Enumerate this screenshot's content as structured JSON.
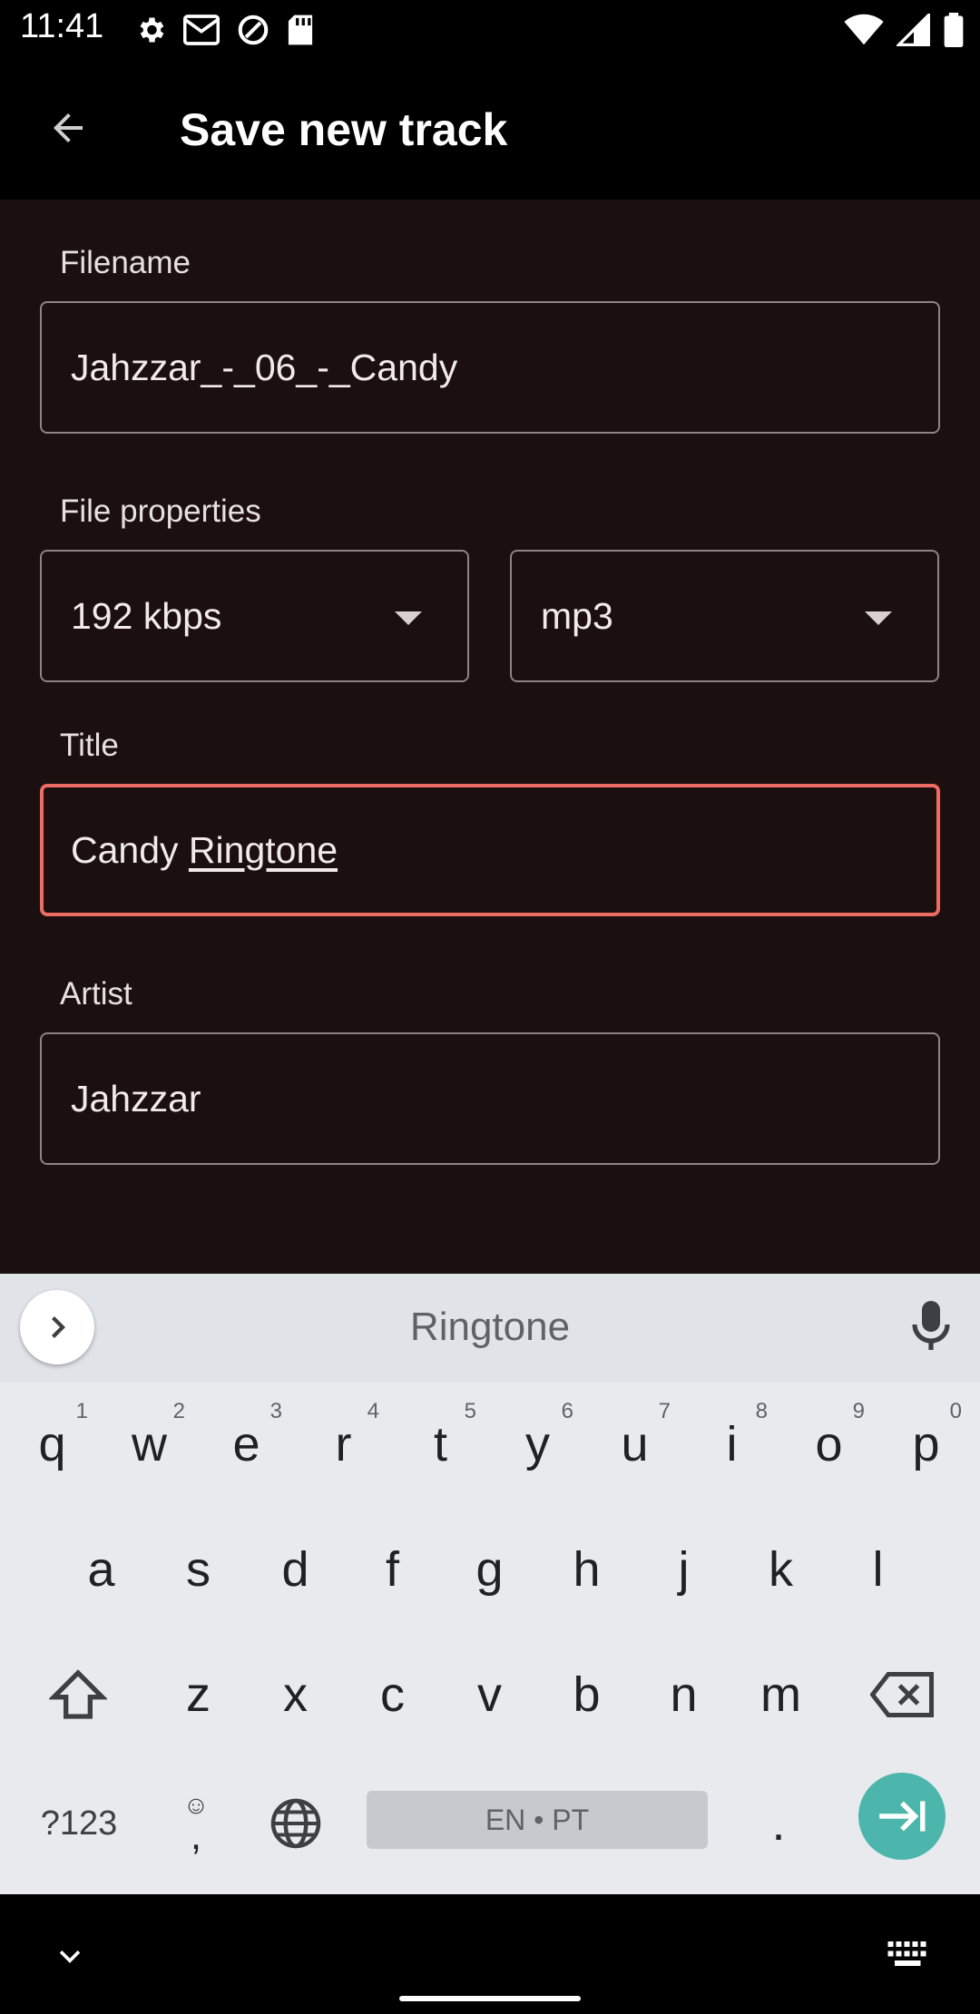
{
  "status_bar": {
    "time": "11:41",
    "left_icons": [
      "settings-icon",
      "gmail-icon",
      "data-saver-icon",
      "sd-card-icon"
    ],
    "right_icons": [
      "wifi-icon",
      "signal-icon",
      "battery-icon"
    ]
  },
  "app_bar": {
    "title": "Save new track",
    "back_icon": "arrow-back-icon"
  },
  "form": {
    "filename_label": "Filename",
    "filename_value": "Jahzzar_-_06_-_Candy",
    "file_properties_label": "File properties",
    "bitrate_value": "192 kbps",
    "format_value": "mp3",
    "title_label": "Title",
    "title_value_plain": "Candy ",
    "title_value_composing": "Ringtone",
    "artist_label": "Artist",
    "artist_value": "Jahzzar"
  },
  "keyboard": {
    "suggestion": "Ringtone",
    "row1": [
      {
        "key": "q",
        "hint": "1"
      },
      {
        "key": "w",
        "hint": "2"
      },
      {
        "key": "e",
        "hint": "3"
      },
      {
        "key": "r",
        "hint": "4"
      },
      {
        "key": "t",
        "hint": "5"
      },
      {
        "key": "y",
        "hint": "6"
      },
      {
        "key": "u",
        "hint": "7"
      },
      {
        "key": "i",
        "hint": "8"
      },
      {
        "key": "o",
        "hint": "9"
      },
      {
        "key": "p",
        "hint": "0"
      }
    ],
    "row2": [
      "a",
      "s",
      "d",
      "f",
      "g",
      "h",
      "j",
      "k",
      "l"
    ],
    "row3": [
      "z",
      "x",
      "c",
      "v",
      "b",
      "n",
      "m"
    ],
    "symbols_key": "?123",
    "comma_key": ",",
    "space_label": "EN • PT",
    "period_key": "."
  },
  "colors": {
    "form_background": "#1b0f0f",
    "focused_border": "#ee6b63",
    "enter_key": "#4db6ac",
    "keyboard_background": "#e8eaed"
  }
}
